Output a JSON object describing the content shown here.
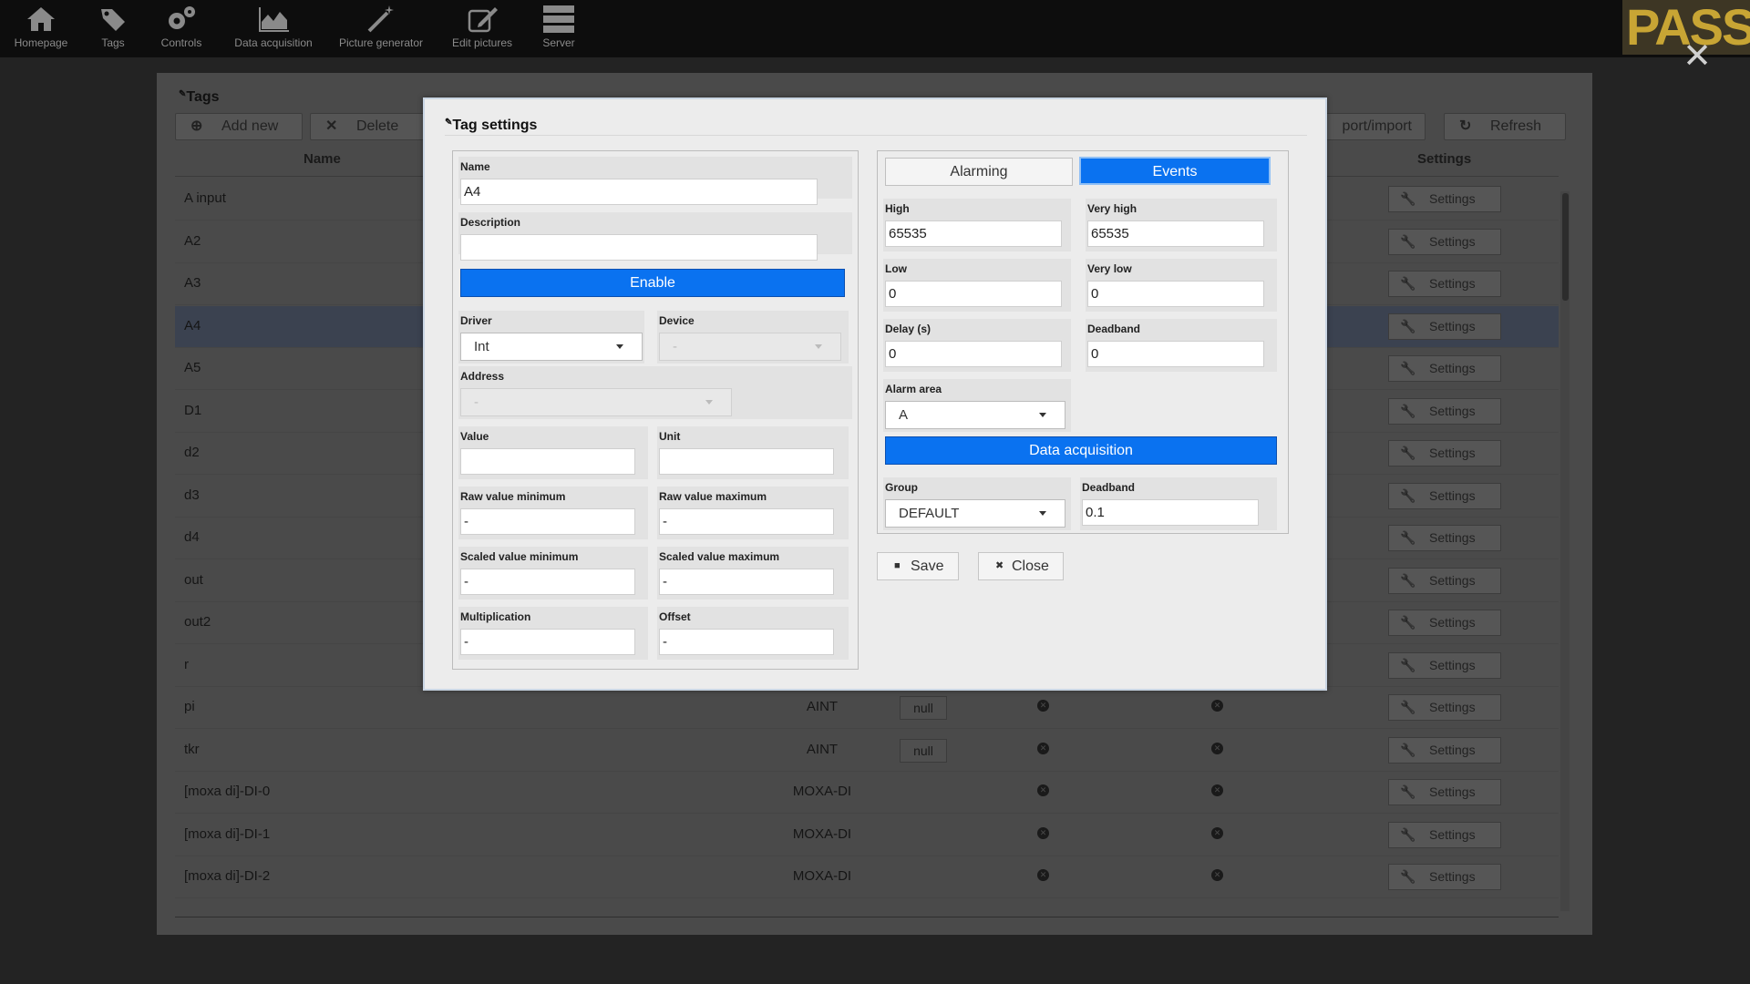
{
  "nav": [
    {
      "label": "Homepage",
      "icon": "home-icon"
    },
    {
      "label": "Tags",
      "icon": "tags-icon"
    },
    {
      "label": "Controls",
      "icon": "gears-icon"
    },
    {
      "label": "Data acquisition",
      "icon": "area-chart-icon"
    },
    {
      "label": "Picture generator",
      "icon": "magic-wand-icon"
    },
    {
      "label": "Edit pictures",
      "icon": "edit-icon"
    },
    {
      "label": "Server",
      "icon": "server-icon"
    }
  ],
  "logo": "PASS",
  "background": {
    "title": "Tags",
    "buttons": {
      "add": "Add new",
      "delete": "Delete",
      "export": "port/import",
      "refresh": "Refresh"
    },
    "columns": {
      "name": "Name",
      "settings": "Settings"
    },
    "settings_label": "Settings",
    "rows": [
      {
        "name": "A input",
        "driver": "",
        "null": "",
        "selected": false
      },
      {
        "name": "A2",
        "driver": "",
        "null": "",
        "selected": false
      },
      {
        "name": "A3",
        "driver": "",
        "null": "",
        "selected": false
      },
      {
        "name": "A4",
        "driver": "",
        "null": "",
        "selected": true
      },
      {
        "name": "A5",
        "driver": "",
        "null": "",
        "selected": false
      },
      {
        "name": "D1",
        "driver": "",
        "null": "",
        "selected": false
      },
      {
        "name": "d2",
        "driver": "",
        "null": "",
        "selected": false
      },
      {
        "name": "d3",
        "driver": "",
        "null": "",
        "selected": false
      },
      {
        "name": "d4",
        "driver": "",
        "null": "",
        "selected": false
      },
      {
        "name": "out",
        "driver": "",
        "null": "",
        "selected": false
      },
      {
        "name": "out2",
        "driver": "",
        "null": "",
        "selected": false
      },
      {
        "name": "r",
        "driver": "",
        "null": "",
        "selected": false
      },
      {
        "name": "pi",
        "driver": "AINT",
        "null": "null",
        "selected": false
      },
      {
        "name": "tkr",
        "driver": "AINT",
        "null": "null",
        "selected": false
      },
      {
        "name": "[moxa di]-DI-0",
        "driver": "MOXA-DI",
        "null": "",
        "selected": false
      },
      {
        "name": "[moxa di]-DI-1",
        "driver": "MOXA-DI",
        "null": "",
        "selected": false
      },
      {
        "name": "[moxa di]-DI-2",
        "driver": "MOXA-DI",
        "null": "",
        "selected": false
      }
    ]
  },
  "modal": {
    "title": "Tag settings",
    "left": {
      "name_label": "Name",
      "name_value": "A4",
      "description_label": "Description",
      "description_value": "",
      "enable_label": "Enable",
      "driver_label": "Driver",
      "driver_value": "Int",
      "device_label": "Device",
      "device_value": "-",
      "address_label": "Address",
      "address_value": "-",
      "value_label": "Value",
      "value_value": "",
      "unit_label": "Unit",
      "unit_value": "",
      "raw_min_label": "Raw value minimum",
      "raw_min_value": "-",
      "raw_max_label": "Raw value maximum",
      "raw_max_value": "-",
      "scaled_min_label": "Scaled value minimum",
      "scaled_min_value": "-",
      "scaled_max_label": "Scaled value maximum",
      "scaled_max_value": "-",
      "mult_label": "Multiplication",
      "mult_value": "-",
      "offset_label": "Offset",
      "offset_value": "-"
    },
    "right": {
      "tab_alarming": "Alarming",
      "tab_events": "Events",
      "high_label": "High",
      "high_value": "65535",
      "very_high_label": "Very high",
      "very_high_value": "65535",
      "low_label": "Low",
      "low_value": "0",
      "very_low_label": "Very low",
      "very_low_value": "0",
      "delay_label": "Delay (s)",
      "delay_value": "0",
      "deadband_label": "Deadband",
      "deadband_value": "0",
      "alarm_area_label": "Alarm area",
      "alarm_area_value": "A",
      "data_acq_label": "Data acquisition",
      "group_label": "Group",
      "group_value": "DEFAULT",
      "deadband2_label": "Deadband",
      "deadband2_value": "0.1"
    },
    "save_label": "Save",
    "close_label": "Close"
  },
  "colors": {
    "accent": "#0a72f0",
    "selected_row": "#3b4250",
    "logo": "#c8a534"
  }
}
